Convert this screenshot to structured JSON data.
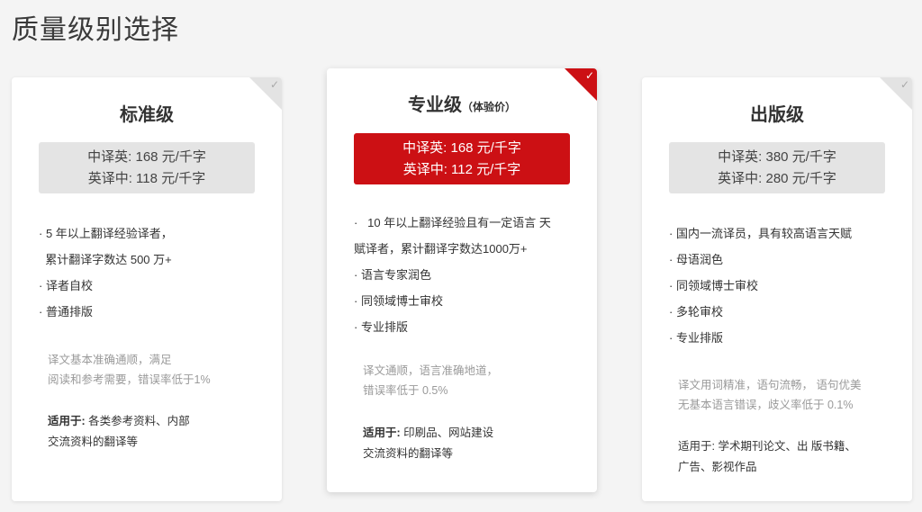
{
  "page_title": "质量级别选择",
  "colors": {
    "accent_red": "#cc1014",
    "price_gray": "#e4e4e4"
  },
  "tiers": [
    {
      "name": "标准级",
      "subtitle": "",
      "price_zh_en": "中译英: 168 元/千字",
      "price_en_zh": "英译中: 118 元/千字",
      "selected": false,
      "features": [
        "· 5 年以上翻译经验译者，",
        "  累计翻译字数达 500 万+",
        "· 译者自校",
        "· 普通排版"
      ],
      "note": [
        "译文基本准确通顺，满足",
        "阅读和参考需要，错误率低于1%"
      ],
      "suitable_label": "适用于:",
      "suitable_text_1": " 各类参考资料、内部",
      "suitable_text_2": "交流资料的翻译等"
    },
    {
      "name": "专业级",
      "subtitle": "（体验价）",
      "price_zh_en": "中译英: 168 元/千字",
      "price_en_zh": "英译中: 112 元/千字",
      "selected": true,
      "features": [
        "·   10 年以上翻译经验且有一定语言 天",
        "赋译者，累计翻译字数达1000万+",
        "· 语言专家润色",
        "· 同领域博士审校",
        "· 专业排版"
      ],
      "note": [
        "译文通顺，语言准确地道，",
        "错误率低于 0.5%"
      ],
      "suitable_label": "适用于:",
      "suitable_text_1": " 印刷品、网站建设",
      "suitable_text_2": "交流资料的翻译等"
    },
    {
      "name": "出版级",
      "subtitle": "",
      "price_zh_en": "中译英: 380 元/千字",
      "price_en_zh": "英译中: 280 元/千字",
      "selected": false,
      "features": [
        "· 国内一流译员，具有较高语言天赋",
        "· 母语润色",
        "· 同领域博士审校",
        "· 多轮审校",
        "· 专业排版"
      ],
      "note": [
        "译文用词精准，语句流畅， 语句优美",
        "无基本语言错误，歧义率低于 0.1%"
      ],
      "suitable_label": "",
      "suitable_text_1": "适用于: 学术期刊论文、出 版书籍、",
      "suitable_text_2": "广告、影视作品"
    }
  ],
  "check_glyph": "✓"
}
